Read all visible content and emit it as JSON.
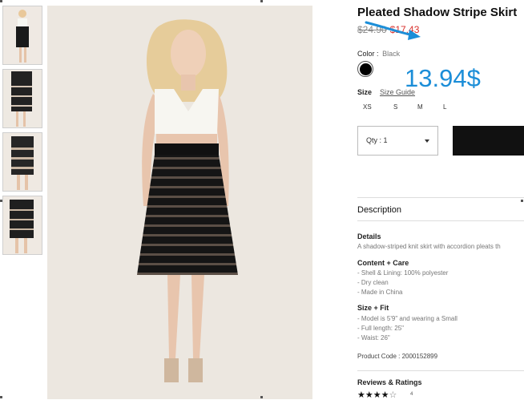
{
  "product": {
    "title": "Pleated Shadow Stripe Skirt",
    "original_price": "$24.90",
    "sale_price": "$17.43",
    "annotation_price": "13.94$",
    "annotation_color": "#1c8ed8",
    "sale_color": "#d9302c"
  },
  "color": {
    "label": "Color",
    "sep": ":",
    "value": "Black",
    "swatch_hex": "#000000"
  },
  "size": {
    "label": "Size",
    "guide_label": "Size Guide",
    "options": [
      "XS",
      "S",
      "M",
      "L"
    ]
  },
  "quantity": {
    "label": "Qty : 1",
    "icon": "caret-down-icon"
  },
  "description": {
    "heading": "Description",
    "details_title": "Details",
    "details_text": "A shadow-striped knit skirt with accordion pleats th",
    "content_title": "Content + Care",
    "content_lines": [
      "- Shell & Lining: 100% polyester",
      "- Dry clean",
      "- Made in China"
    ],
    "fit_title": "Size + Fit",
    "fit_lines": [
      "- Model is 5'9\" and wearing a Small",
      "- Full length: 25\"",
      "- Waist: 26\""
    ],
    "product_code": "Product Code : 2000152899"
  },
  "reviews": {
    "title": "Reviews & Ratings",
    "rating_stars": 4,
    "max_stars": 5,
    "count": "4"
  }
}
